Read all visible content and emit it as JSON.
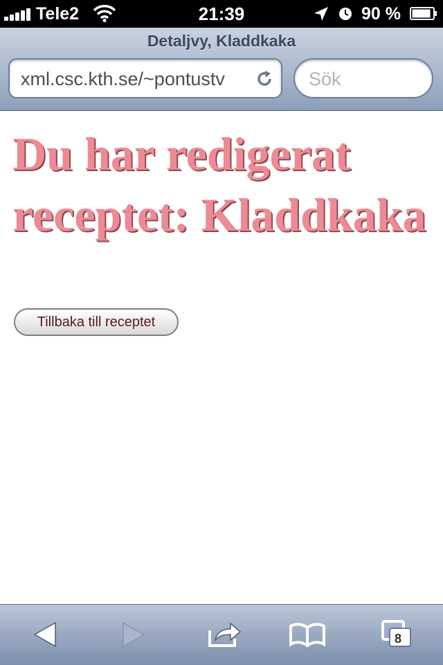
{
  "status_bar": {
    "carrier": "Tele2",
    "time": "21:39",
    "battery_percent": "90 %",
    "signal_bars": 5,
    "battery_level": 0.9
  },
  "browser": {
    "page_title": "Detaljvy, Kladdkaka",
    "url": "xml.csc.kth.se/~pontustv",
    "search_placeholder": "Sök",
    "open_tabs_count": "8"
  },
  "content": {
    "heading": "Du har redigerat receptet: Kladdkaka",
    "back_button_label": "Tillbaka till receptet"
  },
  "icons": {
    "signal": "signal-bars-icon",
    "wifi": "wifi-icon",
    "location": "location-arrow-icon",
    "alarm": "clock-icon",
    "battery": "battery-icon",
    "reload": "reload-icon",
    "back": "back-arrow-icon",
    "forward": "forward-arrow-icon",
    "share": "share-icon",
    "bookmarks": "bookmarks-icon",
    "tabs": "tabs-icon"
  },
  "colors": {
    "heading": "#ee8a94",
    "heading_shadow": "#8a4b52",
    "button_text": "#5c1818"
  }
}
